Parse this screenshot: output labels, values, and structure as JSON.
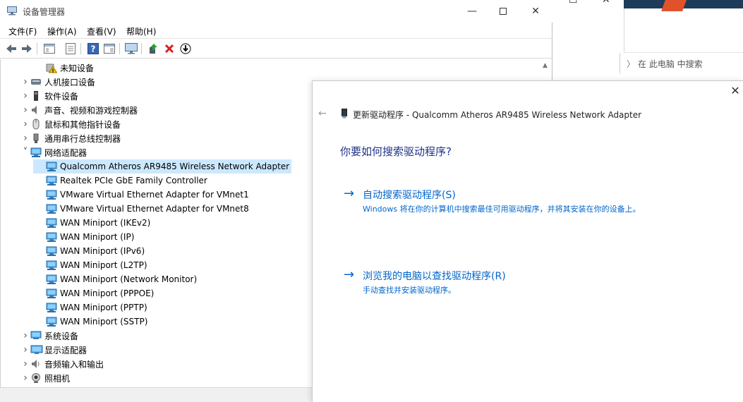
{
  "background_window": {
    "search_placeholder": "在 此电脑 中搜索"
  },
  "device_manager": {
    "title": "设备管理器",
    "menu": [
      "文件(F)",
      "操作(A)",
      "查看(V)",
      "帮助(H)"
    ],
    "tree": [
      {
        "label": "未知设备",
        "indent": 2,
        "icon": "unknown-device-icon",
        "chev": ""
      },
      {
        "label": "人机接口设备",
        "indent": 1,
        "icon": "hid-icon",
        "chev": ">"
      },
      {
        "label": "软件设备",
        "indent": 1,
        "icon": "software-device-icon",
        "chev": ">"
      },
      {
        "label": "声音、视频和游戏控制器",
        "indent": 1,
        "icon": "sound-icon",
        "chev": ">"
      },
      {
        "label": "鼠标和其他指针设备",
        "indent": 1,
        "icon": "mouse-icon",
        "chev": ">"
      },
      {
        "label": "通用串行总线控制器",
        "indent": 1,
        "icon": "usb-icon",
        "chev": ">"
      },
      {
        "label": "网络适配器",
        "indent": 1,
        "icon": "network-adapter-icon",
        "chev": "v"
      },
      {
        "label": "Qualcomm Atheros AR9485 Wireless Network Adapter",
        "indent": 2,
        "icon": "network-adapter-icon",
        "chev": "",
        "selected": true
      },
      {
        "label": "Realtek PCIe GbE Family Controller",
        "indent": 2,
        "icon": "network-adapter-icon",
        "chev": ""
      },
      {
        "label": "VMware Virtual Ethernet Adapter for VMnet1",
        "indent": 2,
        "icon": "network-adapter-icon",
        "chev": ""
      },
      {
        "label": "VMware Virtual Ethernet Adapter for VMnet8",
        "indent": 2,
        "icon": "network-adapter-icon",
        "chev": ""
      },
      {
        "label": "WAN Miniport (IKEv2)",
        "indent": 2,
        "icon": "network-adapter-icon",
        "chev": ""
      },
      {
        "label": "WAN Miniport (IP)",
        "indent": 2,
        "icon": "network-adapter-icon",
        "chev": ""
      },
      {
        "label": "WAN Miniport (IPv6)",
        "indent": 2,
        "icon": "network-adapter-icon",
        "chev": ""
      },
      {
        "label": "WAN Miniport (L2TP)",
        "indent": 2,
        "icon": "network-adapter-icon",
        "chev": ""
      },
      {
        "label": "WAN Miniport (Network Monitor)",
        "indent": 2,
        "icon": "network-adapter-icon",
        "chev": ""
      },
      {
        "label": "WAN Miniport (PPPOE)",
        "indent": 2,
        "icon": "network-adapter-icon",
        "chev": ""
      },
      {
        "label": "WAN Miniport (PPTP)",
        "indent": 2,
        "icon": "network-adapter-icon",
        "chev": ""
      },
      {
        "label": "WAN Miniport (SSTP)",
        "indent": 2,
        "icon": "network-adapter-icon",
        "chev": ""
      },
      {
        "label": "系统设备",
        "indent": 1,
        "icon": "system-device-icon",
        "chev": ">"
      },
      {
        "label": "显示适配器",
        "indent": 1,
        "icon": "display-adapter-icon",
        "chev": ">"
      },
      {
        "label": "音频输入和输出",
        "indent": 1,
        "icon": "audio-icon",
        "chev": ">"
      },
      {
        "label": "照相机",
        "indent": 1,
        "icon": "camera-icon",
        "chev": ">"
      }
    ]
  },
  "dialog": {
    "title": "更新驱动程序 - Qualcomm Atheros AR9485 Wireless Network Adapter",
    "question": "你要如何搜索驱动程序?",
    "options": [
      {
        "title": "自动搜索驱动程序(S)",
        "desc": "Windows 将在你的计算机中搜索最佳可用驱动程序，并将其安装在你的设备上。"
      },
      {
        "title": "浏览我的电脑以查找驱动程序(R)",
        "desc": "手动查找并安装驱动程序。"
      }
    ]
  },
  "colors": {
    "accent_link": "#0066cc",
    "heading": "#1e3287",
    "selection": "#cce8ff"
  }
}
